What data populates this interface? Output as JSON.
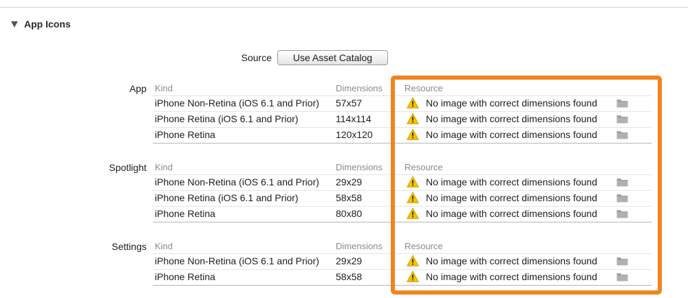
{
  "section": {
    "title": "App Icons"
  },
  "source": {
    "label": "Source",
    "button": "Use Asset Catalog"
  },
  "columns": {
    "kind": "Kind",
    "dimensions": "Dimensions",
    "resource": "Resource"
  },
  "groups": [
    {
      "label": "App",
      "rows": [
        {
          "kind": "iPhone Non-Retina (iOS 6.1 and Prior)",
          "dimensions": "57x57",
          "resource": "No image with correct dimensions found"
        },
        {
          "kind": "iPhone Retina (iOS 6.1 and Prior)",
          "dimensions": "114x114",
          "resource": "No image with correct dimensions found"
        },
        {
          "kind": "iPhone Retina",
          "dimensions": "120x120",
          "resource": "No image with correct dimensions found"
        }
      ]
    },
    {
      "label": "Spotlight",
      "rows": [
        {
          "kind": "iPhone Non-Retina (iOS 6.1 and Prior)",
          "dimensions": "29x29",
          "resource": "No image with correct dimensions found"
        },
        {
          "kind": "iPhone Retina (iOS 6.1 and Prior)",
          "dimensions": "58x58",
          "resource": "No image with correct dimensions found"
        },
        {
          "kind": "iPhone Retina",
          "dimensions": "80x80",
          "resource": "No image with correct dimensions found"
        }
      ]
    },
    {
      "label": "Settings",
      "rows": [
        {
          "kind": "iPhone Non-Retina (iOS 6.1 and Prior)",
          "dimensions": "29x29",
          "resource": "No image with correct dimensions found"
        },
        {
          "kind": "iPhone Retina",
          "dimensions": "58x58",
          "resource": "No image with correct dimensions found"
        }
      ]
    }
  ],
  "colors": {
    "highlight": "#f0851f",
    "warning": "#f5c400"
  },
  "icons": {
    "warning": "warning-icon",
    "folder": "folder-icon",
    "disclosure": "disclosure-triangle-icon"
  }
}
